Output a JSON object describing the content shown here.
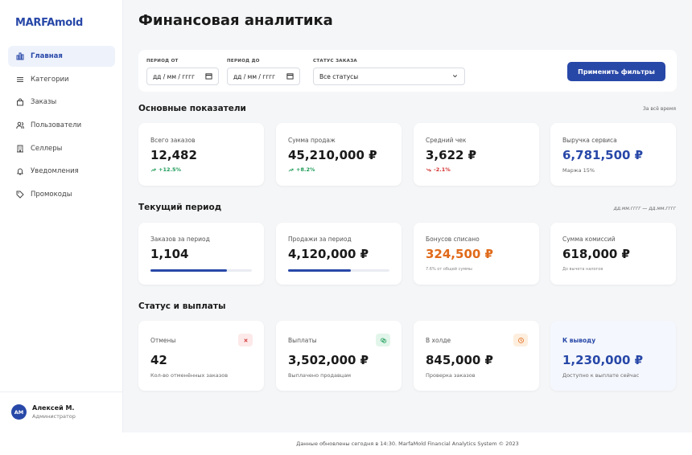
{
  "app": {
    "logo": "MARFAmold"
  },
  "sidebar": {
    "items": [
      {
        "label": "Главная",
        "icon": "bar-chart-icon",
        "active": true
      },
      {
        "label": "Категории",
        "icon": "menu-lines-icon"
      },
      {
        "label": "Заказы",
        "icon": "shopping-bag-icon"
      },
      {
        "label": "Пользователи",
        "icon": "users-icon"
      },
      {
        "label": "Селлеры",
        "icon": "building-icon"
      },
      {
        "label": "Уведомления",
        "icon": "bell-icon"
      },
      {
        "label": "Промокоды",
        "icon": "tag-icon"
      }
    ],
    "user": {
      "initials": "АМ",
      "name": "Алексей М.",
      "role": "Администратор"
    }
  },
  "header": {
    "title": "Финансовая аналитика"
  },
  "filters": {
    "date_from": {
      "label": "ПЕРИОД ОТ",
      "value": "дд / мм / гггг"
    },
    "date_to": {
      "label": "ПЕРИОД ДО",
      "value": "дд / мм / гггг"
    },
    "status": {
      "label": "СТАТУС ЗАКАЗА",
      "value": "Все статусы"
    },
    "apply_label": "Применить фильтры"
  },
  "sections": {
    "main_kpi": {
      "title": "Основные показатели",
      "note": "За всё время",
      "cards": [
        {
          "label": "Всего заказов",
          "value": "12,482",
          "trend": "+12.5%",
          "trend_dir": "up"
        },
        {
          "label": "Сумма продаж",
          "value": "45,210,000 ₽",
          "trend": "+8.2%",
          "trend_dir": "up"
        },
        {
          "label": "Средний чек",
          "value": "3,622 ₽",
          "trend": "-2.1%",
          "trend_dir": "down"
        },
        {
          "label": "Выручка сервиса",
          "value": "6,781,500 ₽",
          "sub": "Маржа 15%"
        }
      ]
    },
    "current_period": {
      "title": "Текущий период",
      "note": "дд.мм.гггг — дд.мм.гггг",
      "cards": [
        {
          "label": "Заказов за период",
          "value": "1,104",
          "progress": 0.75
        },
        {
          "label": "Продажи за период",
          "value": "4,120,000 ₽",
          "progress": 0.62
        },
        {
          "label": "Бонусов списано",
          "value": "324,500 ₽",
          "sub": "7.6% от общей суммы"
        },
        {
          "label": "Сумма комиссий",
          "value": "618,000 ₽",
          "sub": "До вычета налогов"
        }
      ]
    },
    "status_payouts": {
      "title": "Статус и выплаты",
      "cards": [
        {
          "label": "Отмены",
          "value": "42",
          "sub": "Кол-во отменённых заказов",
          "icon": "close-icon"
        },
        {
          "label": "Выплаты",
          "value": "3,502,000 ₽",
          "sub": "Выплачено продавцам",
          "icon": "money-icon"
        },
        {
          "label": "В холде",
          "value": "845,000 ₽",
          "sub": "Проверка заказов",
          "icon": "clock-icon"
        },
        {
          "label": "К выводу",
          "value": "1,230,000 ₽",
          "sub": "Доступно к выплате сейчас"
        }
      ]
    }
  },
  "colors": {
    "accent": "#2848a8",
    "up": "#1a9a55",
    "down": "#d32f2f",
    "orange": "#e06a1a"
  },
  "footer": {
    "text": "Данные обновлены сегодня в 14:30. MarfaMold Financial Analytics System © 2023"
  }
}
